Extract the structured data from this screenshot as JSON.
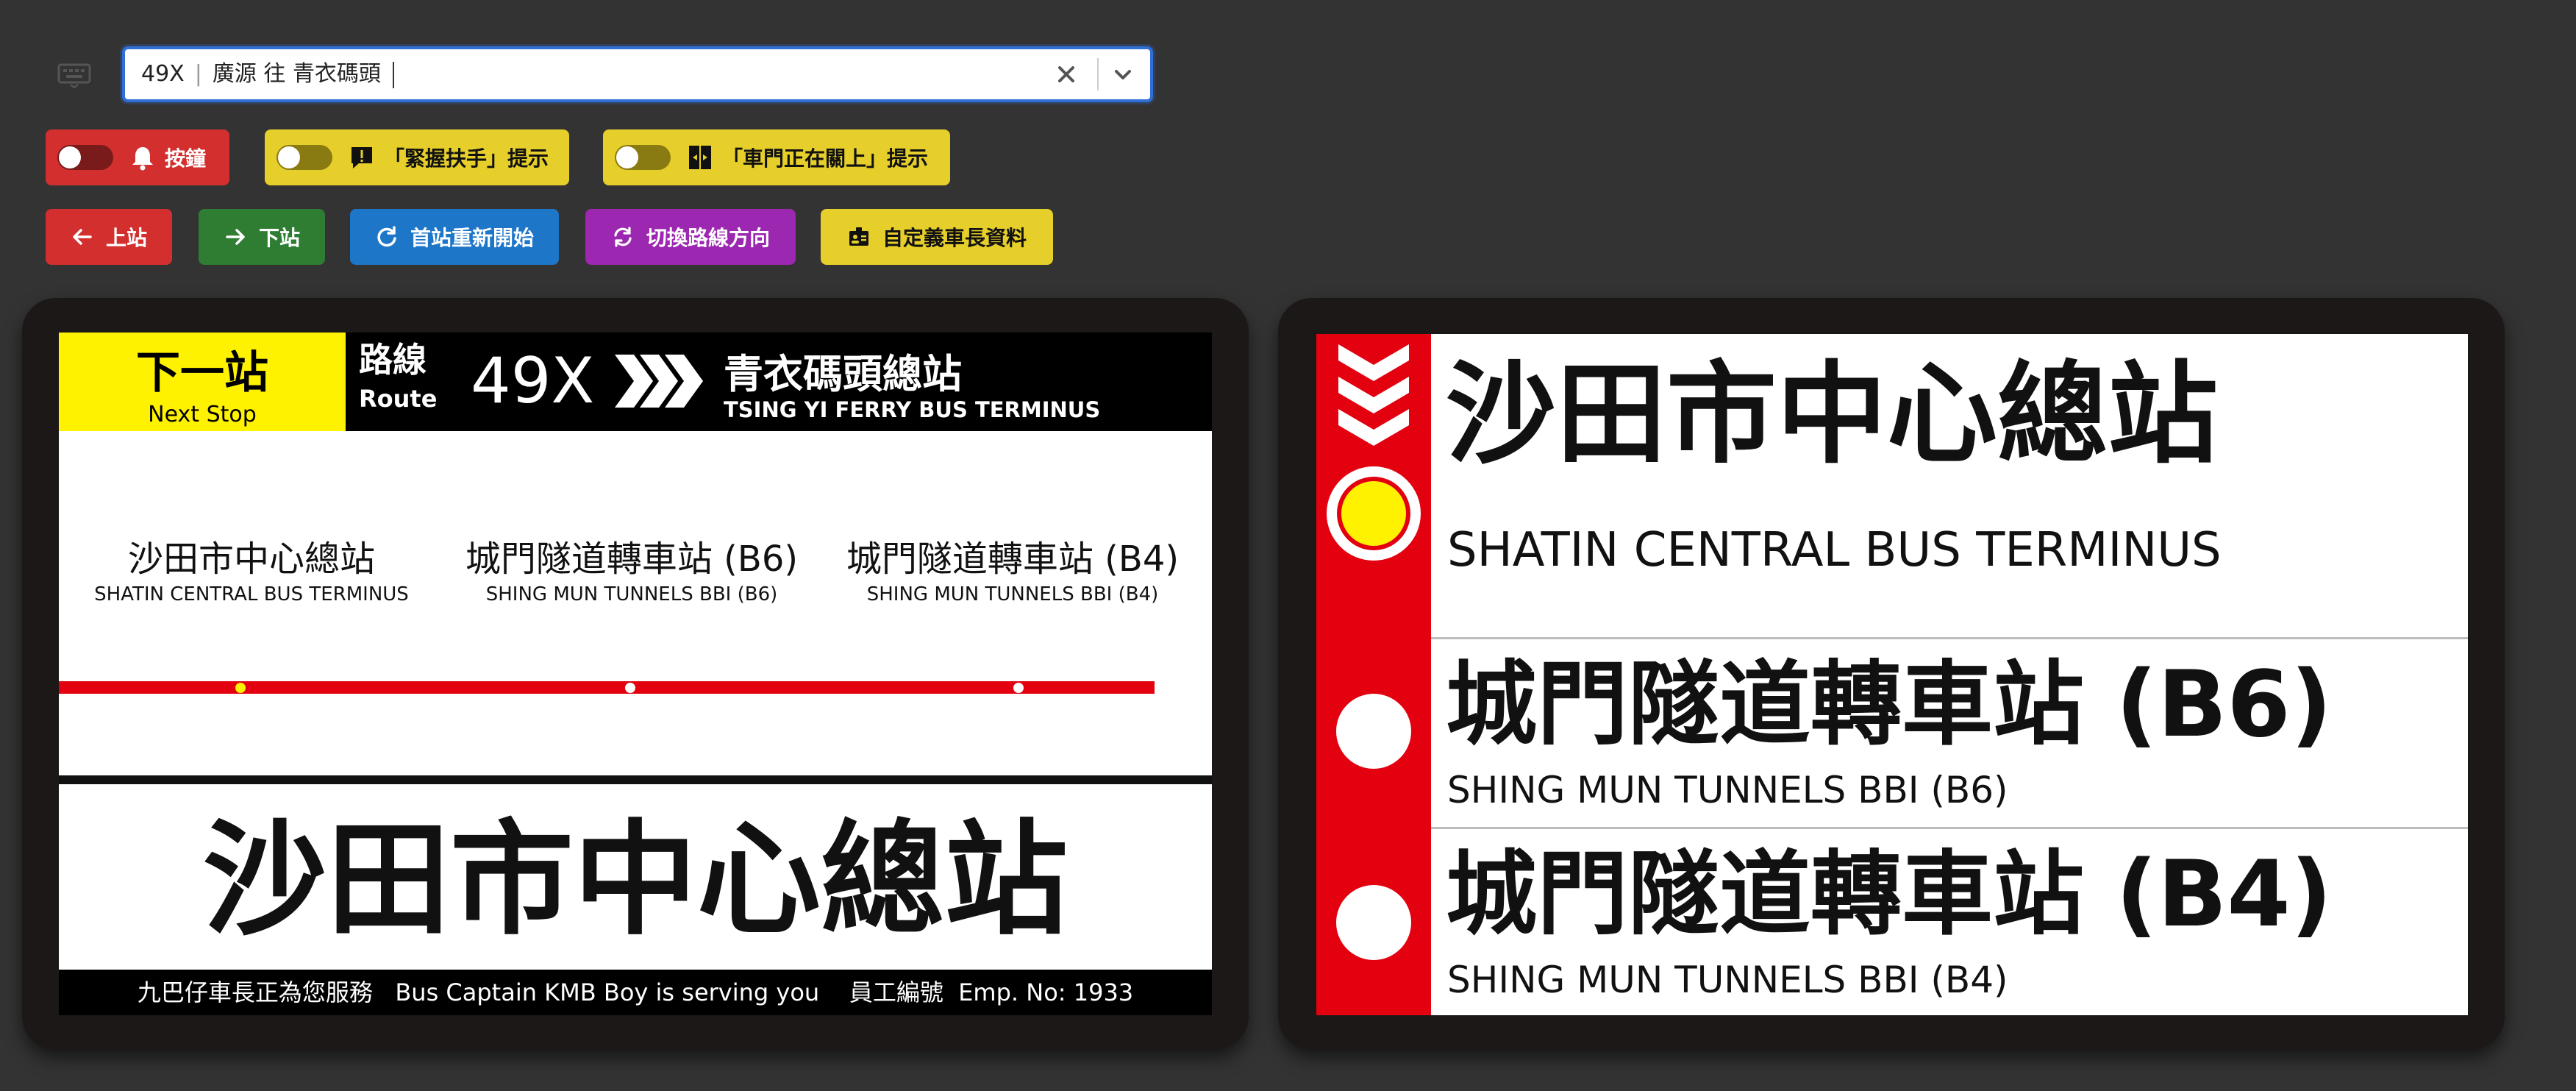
{
  "route_select": {
    "route": "49X",
    "origin": "廣源",
    "via": "往",
    "destination": "青衣碼頭"
  },
  "toggles": [
    {
      "label": "按鐘",
      "icon": "bell-icon",
      "on": false,
      "color": "#d32f2f"
    },
    {
      "label": "「緊握扶手」提示",
      "icon": "exclamation-message-icon",
      "on": false,
      "color": "#e6cf2a"
    },
    {
      "label": "「車門正在關上」提示",
      "icon": "door-closing-icon",
      "on": false,
      "color": "#e6cf2a"
    }
  ],
  "buttons": {
    "prev": "上站",
    "next": "下站",
    "restart": "首站重新開始",
    "switch": "切換路線方向",
    "custom": "自定義車長資料"
  },
  "left_sign": {
    "next_stop_zh": "下一站",
    "next_stop_en": "Next Stop",
    "route_label_zh": "路線",
    "route_label_en": "Route",
    "route_number": "49X",
    "destination_zh": "青衣碼頭總站",
    "destination_en": "TSING YI FERRY BUS TERMINUS",
    "stops": [
      {
        "zh": "沙田市中心總站",
        "en": "SHATIN CENTRAL BUS TERMINUS",
        "current": true
      },
      {
        "zh": "城門隧道轉車站 (B6)",
        "en": "SHING MUN TUNNELS BBI (B6)",
        "current": false
      },
      {
        "zh": "城門隧道轉車站 (B4)",
        "en": "SHING MUN TUNNELS BBI (B4)",
        "current": false
      }
    ],
    "current_stop_zh": "沙田市中心總站",
    "footer": "九巴仔車長正為您服務   Bus Captain KMB Boy is serving you    員工編號  Emp. No: 1933"
  },
  "right_sign": {
    "stops": [
      {
        "zh": "沙田市中心總站",
        "en": "SHATIN CENTRAL BUS TERMINUS",
        "current": true
      },
      {
        "zh": "城門隧道轉車站 (B6)",
        "en": "SHING MUN TUNNELS BBI (B6)",
        "current": false
      },
      {
        "zh": "城門隧道轉車站 (B4)",
        "en": "SHING MUN TUNNELS BBI (B4)",
        "current": false
      }
    ]
  },
  "colors": {
    "background": "#333333",
    "accent_red": "#e3000f",
    "accent_yellow": "#fff200",
    "select_border": "#2f6fd6",
    "btn_prev": "#d32f2f",
    "btn_next": "#2e7d32",
    "btn_restart": "#1e76c8",
    "btn_switch": "#9c27b0",
    "btn_custom": "#e6cf2a"
  }
}
